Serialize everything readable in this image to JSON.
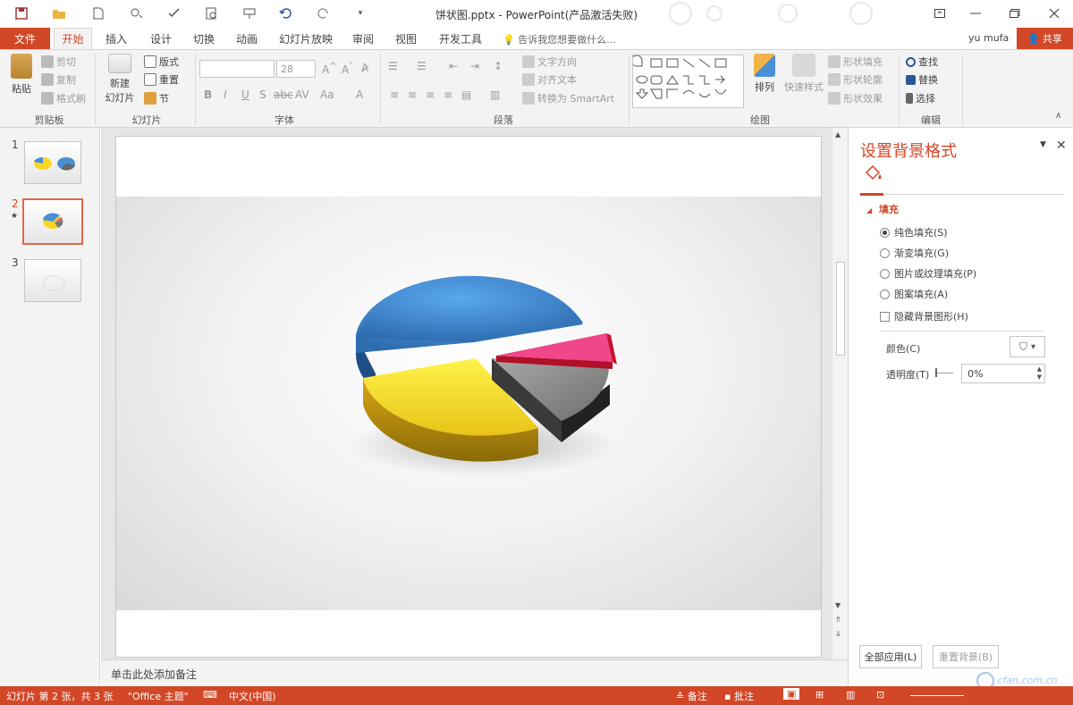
{
  "window": {
    "title": "饼状图.pptx - PowerPoint(产品激活失败)",
    "user": "yu mufa",
    "share": "共享"
  },
  "tabs": {
    "file": "文件",
    "items": [
      "开始",
      "插入",
      "设计",
      "切换",
      "动画",
      "幻灯片放映",
      "审阅",
      "视图",
      "开发工具"
    ],
    "active": "开始",
    "tellme": "告诉我您想要做什么..."
  },
  "ribbon": {
    "clipboard": {
      "paste": "粘贴",
      "cut": "剪切",
      "copy": "复制",
      "format_painter": "格式刷",
      "label": "剪贴板"
    },
    "slides": {
      "new_slide": "新建",
      "new_slide_2": "幻灯片",
      "layout": "版式",
      "reset": "重置",
      "section": "节",
      "label": "幻灯片"
    },
    "font": {
      "font_size": "28",
      "label": "字体"
    },
    "paragraph": {
      "text_direction": "文字方向",
      "align_text": "对齐文本",
      "convert_smartart": "转换为 SmartArt",
      "label": "段落"
    },
    "drawing": {
      "arrange": "排列",
      "quick_styles": "快速样式",
      "shape_fill": "形状填充",
      "shape_outline": "形状轮廓",
      "shape_effects": "形状效果",
      "label": "绘图"
    },
    "editing": {
      "find": "查找",
      "replace": "替换",
      "select": "选择",
      "label": "编辑"
    }
  },
  "thumbnails": [
    {
      "num": "1",
      "selected": false
    },
    {
      "num": "2",
      "selected": true
    },
    {
      "num": "3",
      "selected": false
    }
  ],
  "notes": {
    "placeholder": "单击此处添加备注"
  },
  "format_pane": {
    "title": "设置背景格式",
    "section": "填充",
    "options": [
      {
        "label": "纯色填充(S)",
        "checked": true
      },
      {
        "label": "渐变填充(G)",
        "checked": false
      },
      {
        "label": "图片或纹理填充(P)",
        "checked": false
      },
      {
        "label": "图案填充(A)",
        "checked": false
      }
    ],
    "hide_bg": "隐藏背景图形(H)",
    "color_label": "颜色(C)",
    "transparency_label": "透明度(T)",
    "transparency_value": "0%",
    "apply_all": "全部应用(L)",
    "reset_bg": "重置背景(B)"
  },
  "statusbar": {
    "slide_info": "幻灯片 第 2 张，共 3 张",
    "theme": "\"Office 主题\"",
    "language": "中文(中国)",
    "notes": "备注",
    "comments": "批注"
  },
  "watermark": "cfan.com.cn",
  "colors": {
    "accent": "#d24726",
    "pie_blue": "#4a8fd6",
    "pie_yellow": "#f7d626",
    "pie_gray": "#8a8a8a",
    "pie_pink": "#f0468a"
  }
}
